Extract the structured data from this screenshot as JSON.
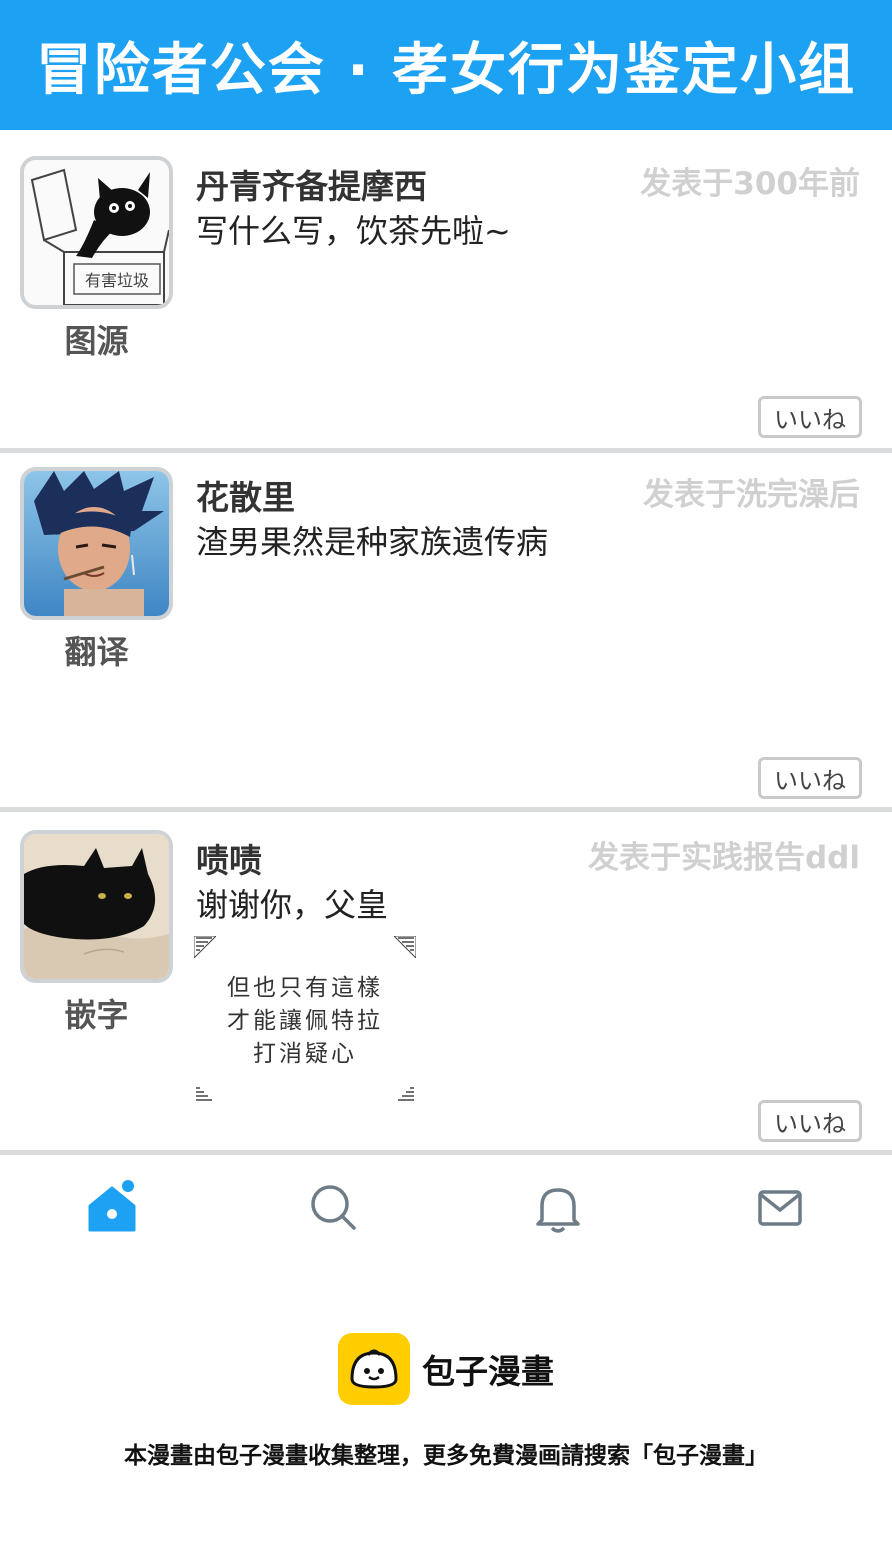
{
  "header": {
    "title": "冒险者公会 · 孝女行为鉴定小组"
  },
  "posts": [
    {
      "role": "图源",
      "username": "丹青齐备提摩西",
      "timestamp": "发表于300年前",
      "message": "写什么写，饮茶先啦~",
      "avatar_caption": "有害垃圾",
      "like_label": "いいね"
    },
    {
      "role": "翻译",
      "username": "花散里",
      "timestamp": "发表于洗完澡后",
      "message": "渣男果然是种家族遗传病",
      "like_label": "いいね"
    },
    {
      "role": "嵌字",
      "username": "啧啧",
      "timestamp": "发表于实践报告ddl",
      "message": "谢谢你，父皇",
      "quote_lines": [
        "但也只有這樣",
        "才能讓佩特拉",
        "打消疑心"
      ],
      "like_label": "いいね"
    }
  ],
  "tabbar": {
    "icons": [
      "home-icon",
      "search-icon",
      "bell-icon",
      "mail-icon"
    ],
    "active_color": "#1da1f2",
    "inactive_color": "#6e7c87"
  },
  "footer": {
    "brand": "包子漫畫",
    "note": "本漫畫由包子漫畫收集整理，更多免費漫画請搜索「包子漫畫」"
  },
  "colors": {
    "header_bg": "#1da1f2",
    "divider": "#d9dbdd"
  }
}
